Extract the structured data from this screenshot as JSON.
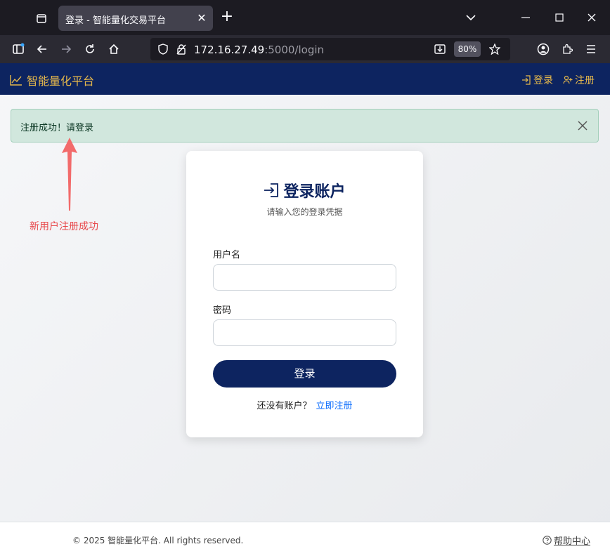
{
  "browser": {
    "tab_title": "登录 - 智能量化交易平台",
    "tab_close": "✕",
    "new_tab": "+",
    "url_host": "172.16.27.49",
    "url_path": ":5000/login",
    "zoom": "80%"
  },
  "site": {
    "brand": "智能量化平台",
    "nav": {
      "login": "登录",
      "register": "注册"
    }
  },
  "alert": {
    "message": "注册成功！请登录"
  },
  "annotation": {
    "text": "新用户注册成功",
    "color": "#e8474a"
  },
  "login_card": {
    "title": "登录账户",
    "subtitle": "请输入您的登录凭据",
    "username_label": "用户名",
    "username_value": "",
    "password_label": "密码",
    "password_value": "",
    "submit_label": "登录",
    "no_account_text": "还没有账户？",
    "register_link": "立即注册"
  },
  "footer": {
    "copyright": "© 2025 智能量化平台. All rights reserved.",
    "help": "帮助中心"
  },
  "colors": {
    "primary": "#0d2460",
    "accent": "#e6b84b",
    "success_bg": "#d1e7dd",
    "link": "#0d6efd"
  }
}
